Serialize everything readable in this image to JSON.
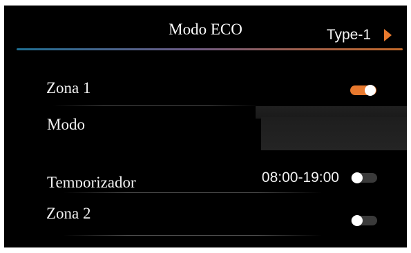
{
  "header": {
    "title": "Modo ECO"
  },
  "settings": {
    "zona1": {
      "label": "Zona 1",
      "enabled": true
    },
    "modo": {
      "label": "Modo",
      "value": "Type-1"
    },
    "temporizador": {
      "label": "Temporizador",
      "value": "08:00-19:00",
      "enabled": false
    },
    "zona2": {
      "label": "Zona 2",
      "enabled": false
    }
  },
  "colors": {
    "accent": "#e8792e",
    "background": "#000000",
    "toggle_off": "#3a3a3a",
    "text": "#f2f2f2"
  }
}
